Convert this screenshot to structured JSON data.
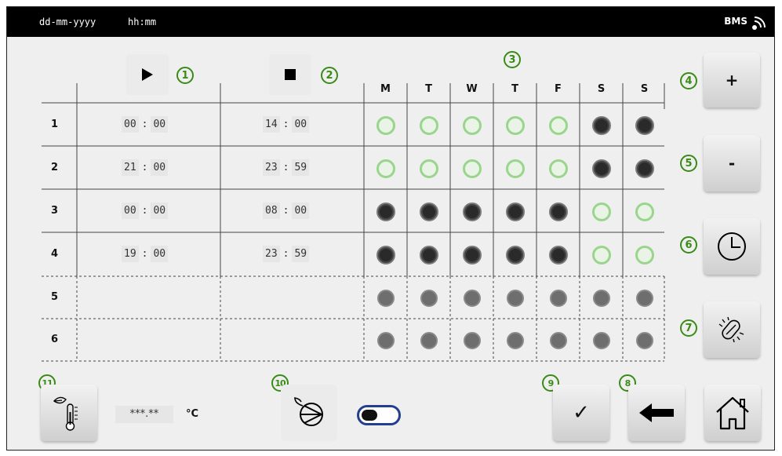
{
  "status_bar": {
    "date": "dd-mm-yyyy",
    "time": "hh:mm",
    "bms_label": "BMS"
  },
  "badges": {
    "start": "1",
    "stop": "2",
    "days": "3",
    "add": "4",
    "remove": "5",
    "clock": "6",
    "clean": "7",
    "back": "8",
    "confirm": "9",
    "pump": "10",
    "temperature": "11"
  },
  "days": [
    "M",
    "T",
    "W",
    "T",
    "F",
    "S",
    "S"
  ],
  "schedule": [
    {
      "num": "1",
      "start_h": "00",
      "start_m": "00",
      "stop_h": "14",
      "stop_m": "00",
      "days": [
        "on",
        "on",
        "on",
        "on",
        "on",
        "off",
        "off"
      ]
    },
    {
      "num": "2",
      "start_h": "21",
      "start_m": "00",
      "stop_h": "23",
      "stop_m": "59",
      "days": [
        "on",
        "on",
        "on",
        "on",
        "on",
        "off",
        "off"
      ]
    },
    {
      "num": "3",
      "start_h": "00",
      "start_m": "00",
      "stop_h": "08",
      "stop_m": "00",
      "days": [
        "off",
        "off",
        "off",
        "off",
        "off",
        "on",
        "on"
      ]
    },
    {
      "num": "4",
      "start_h": "19",
      "start_m": "00",
      "stop_h": "23",
      "stop_m": "59",
      "days": [
        "off",
        "off",
        "off",
        "off",
        "off",
        "on",
        "on"
      ]
    },
    {
      "num": "5",
      "days": [
        "empty",
        "empty",
        "empty",
        "empty",
        "empty",
        "empty",
        "empty"
      ]
    },
    {
      "num": "6",
      "days": [
        "empty",
        "empty",
        "empty",
        "empty",
        "empty",
        "empty",
        "empty"
      ]
    }
  ],
  "buttons": {
    "add": "+",
    "remove": "-",
    "confirm": "✓"
  },
  "temperature": {
    "value": "***.**",
    "unit": "°C"
  },
  "pump_toggle": {
    "state": "off"
  },
  "colors": {
    "accent_green": "#3a8b16",
    "day_on": "#9ad58d",
    "toggle_border": "#23408f"
  },
  "icons": [
    "play-icon",
    "stop-icon",
    "clock-icon",
    "cleaning-brush-icon",
    "back-arrow-icon",
    "checkmark-icon",
    "home-icon",
    "thermometer-leaf-icon",
    "pump-icon",
    "wifi-icon"
  ]
}
